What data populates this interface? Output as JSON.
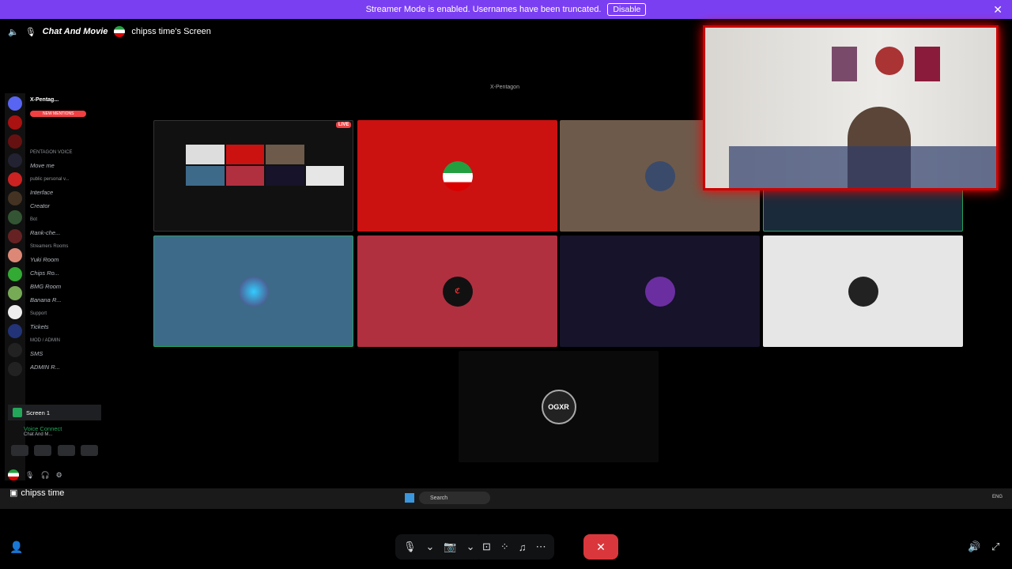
{
  "banner": {
    "text": "Streamer Mode is enabled. Usernames have been truncated.",
    "button": "Disable"
  },
  "topbar": {
    "channel": "Chat And Movie",
    "screen_owner": "chipss time's Screen"
  },
  "shared_window_title": "X-Pentagon",
  "sidebar": {
    "server_name": "X-Pentag...",
    "new_mentions": "NEW MENTIONS",
    "rows": [
      {
        "kind": "cat",
        "text": "PENTAGON VOICE"
      },
      {
        "kind": "chan",
        "text": "Move me"
      },
      {
        "kind": "cat",
        "text": "public personal v..."
      },
      {
        "kind": "chan",
        "text": "Interface"
      },
      {
        "kind": "chan",
        "text": "Creator"
      },
      {
        "kind": "cat",
        "text": "Bot"
      },
      {
        "kind": "chan",
        "text": "Rank-che..."
      },
      {
        "kind": "cat",
        "text": "Streamers Rooms"
      },
      {
        "kind": "chan",
        "text": "Yuki Room"
      },
      {
        "kind": "chan",
        "text": "Chips Ro..."
      },
      {
        "kind": "chan",
        "text": "BMG Room"
      },
      {
        "kind": "chan",
        "text": "Banana R..."
      },
      {
        "kind": "cat",
        "text": "Support"
      },
      {
        "kind": "chan",
        "text": "Tickets"
      },
      {
        "kind": "cat",
        "text": "MOD / ADMIN"
      },
      {
        "kind": "chan",
        "text": "SMS"
      },
      {
        "kind": "chan",
        "text": "ADMIN R..."
      }
    ],
    "screen_label": "Screen 1",
    "voice_status": "Voice Connect",
    "voice_channel": "Chat And M..."
  },
  "live_badge": "LIVE",
  "tiles": [
    {
      "label": "flag",
      "color": "#cc1111"
    },
    {
      "label": "avatar",
      "color": "#6e5a4b"
    },
    {
      "label": "avatar",
      "color": "#3e6a8a"
    },
    {
      "label": "avatar",
      "color": "#b03040"
    },
    {
      "label": "avatar",
      "color": "#16132a"
    },
    {
      "label": "avatar",
      "color": "#e6e6e6"
    },
    {
      "label": "OGXR",
      "color": "#0a0a0a"
    }
  ],
  "ogxr_text": "OGXR",
  "screen_user": "chipss time",
  "taskbar": {
    "search": "Search",
    "lang": "ENG"
  },
  "colors": {
    "accent": "#7b3ff2",
    "end_call": "#da373c"
  }
}
